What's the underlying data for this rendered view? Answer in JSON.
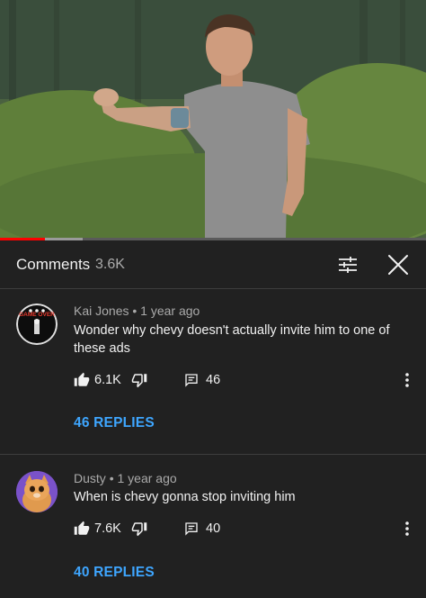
{
  "header": {
    "title": "Comments",
    "count": "3.6K"
  },
  "video": {
    "progress_fraction": 0.105,
    "buffered_fraction": 0.195
  },
  "comments": [
    {
      "author": "Kai Jones",
      "separator": "•",
      "time": "1 year ago",
      "text": "Wonder why chevy doesn't actually invite him to one of these ads",
      "likes": "6.1K",
      "reply_count": "46",
      "replies_label": "46 REPLIES",
      "avatar_caption": "GAME OVER"
    },
    {
      "author": "Dusty",
      "separator": "•",
      "time": "1 year ago",
      "text": "When is chevy gonna stop inviting him",
      "likes": "7.6K",
      "reply_count": "40",
      "replies_label": "40 REPLIES"
    }
  ],
  "colors": {
    "background": "#212121",
    "text": "#f1f1f1",
    "secondary_text": "#aaaaaa",
    "link": "#3ea6ff",
    "progress": "#ff0000"
  },
  "icons": {
    "filter": "tune-icon",
    "close": "close-icon",
    "like": "thumb-up-icon",
    "dislike": "thumb-down-icon",
    "reply": "comment-icon",
    "more": "more-vert-icon"
  }
}
